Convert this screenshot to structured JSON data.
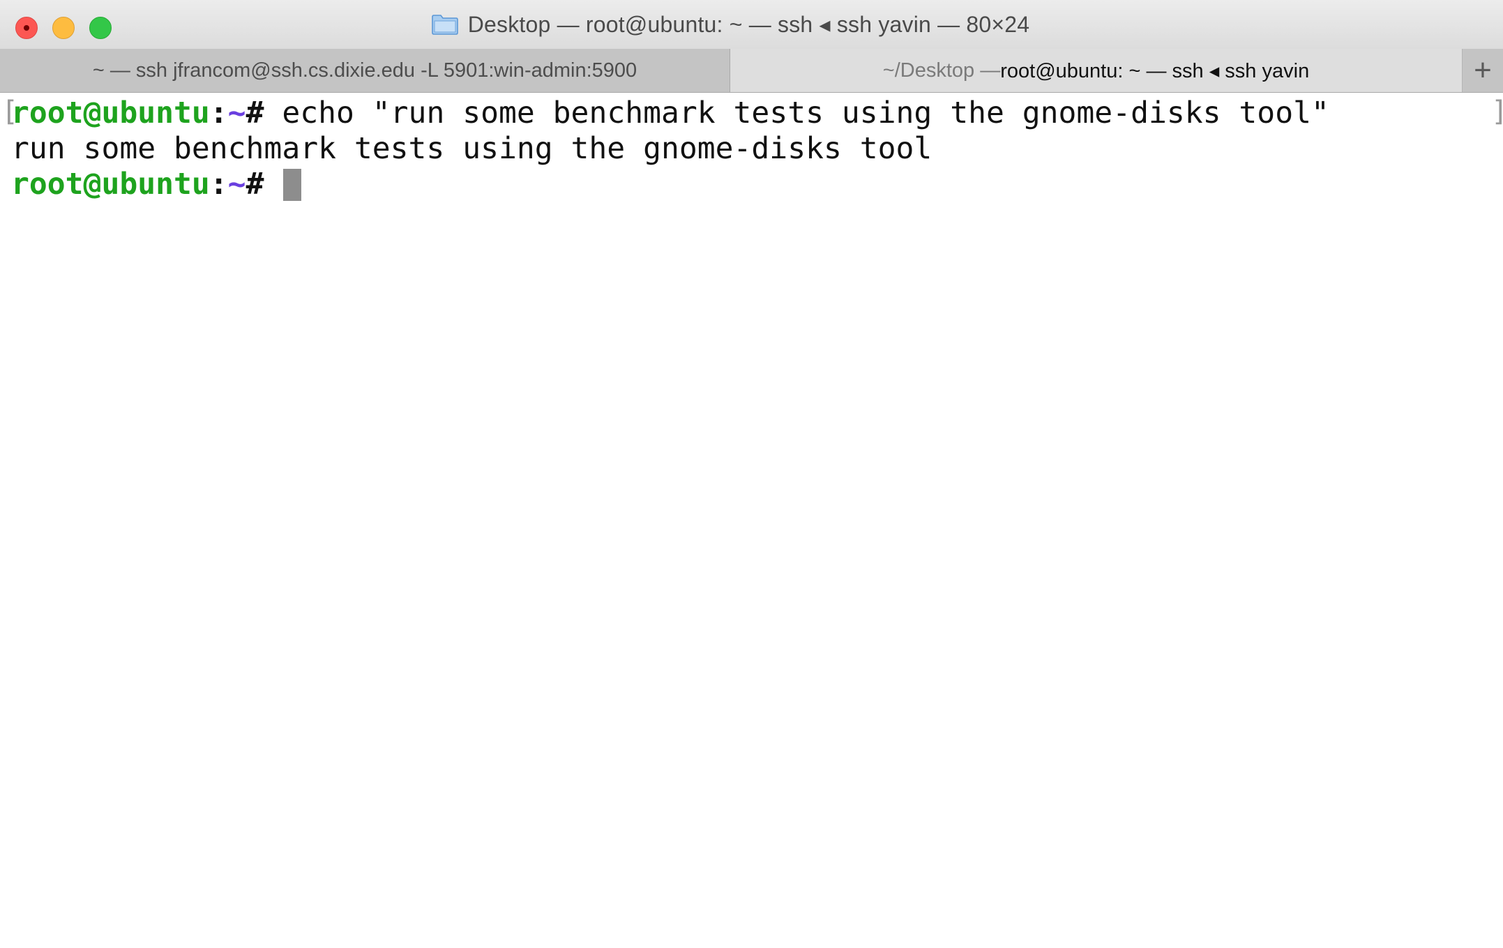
{
  "window": {
    "title": "Desktop — root@ubuntu: ~ — ssh ◂ ssh yavin — 80×24",
    "folder_icon": "folder-icon",
    "traffic_lights": {
      "close_color": "#fc5753",
      "minimize_color": "#fdbc40",
      "zoom_color": "#33c748"
    }
  },
  "tabs": [
    {
      "label": "~ — ssh jfrancom@ssh.cs.dixie.edu -L 5901:win-admin:5900",
      "active": false
    },
    {
      "label_prefix": "~/Desktop — ",
      "label_main": "root@ubuntu: ~ — ssh ◂ ssh yavin",
      "active": true
    }
  ],
  "new_tab_label": "+",
  "terminal": {
    "prompt_user": "root@ubuntu",
    "prompt_sep": ":",
    "prompt_path": "~",
    "prompt_hash": "#",
    "command": " echo \"run some benchmark tests using the gnome-disks tool\"",
    "output": "run some benchmark tests using the gnome-disks tool",
    "colors": {
      "user": "#1ea31e",
      "path": "#6a3fe0",
      "text": "#111111",
      "cursor": "#8d8d8d"
    }
  }
}
